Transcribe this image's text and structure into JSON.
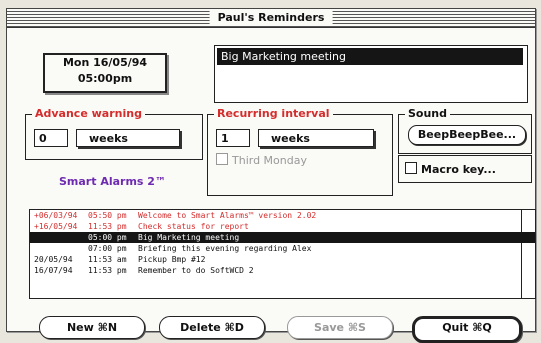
{
  "window": {
    "title": "Paul's Reminders"
  },
  "date_display": {
    "line1": "Mon 16/05/94",
    "line2": "05:00pm"
  },
  "message": {
    "text": "Big Marketing meeting"
  },
  "advance_warning": {
    "label": "Advance warning",
    "value": "0",
    "unit": "weeks"
  },
  "recurring_interval": {
    "label": "Recurring interval",
    "value": "1",
    "unit": "weeks",
    "third_monday": "Third Monday"
  },
  "sound": {
    "label": "Sound",
    "button": "BeepBeepBee..."
  },
  "macro_key": {
    "label": "Macro key..."
  },
  "smart_alarms": {
    "text": "Smart Alarms 2™"
  },
  "reminders": [
    {
      "date": "+06/03/94",
      "time": "05:50 pm",
      "text": "Welcome to Smart Alarms™ version 2.02",
      "style": "red"
    },
    {
      "date": "+16/05/94",
      "time": "11:53 pm",
      "text": "Check status for report",
      "style": "red"
    },
    {
      "date": "",
      "time": "05:00 pm",
      "text": "Big Marketing meeting",
      "style": "selected"
    },
    {
      "date": "",
      "time": "07:00 pm",
      "text": "Briefing this evening regarding Alex",
      "style": "normal"
    },
    {
      "date": "20/05/94",
      "time": "11:53 am",
      "text": "Pickup Bmp #12",
      "style": "normal"
    },
    {
      "date": "16/07/94",
      "time": "11:53 pm",
      "text": "Remember to do SoftWCD 2",
      "style": "normal"
    }
  ],
  "buttons": {
    "new": "New ⌘N",
    "delete": "Delete ⌘D",
    "save": "Save ⌘S",
    "quit": "Quit ⌘Q"
  },
  "colors": {
    "accent_red": "#d42d2d",
    "accent_purple": "#6e2bb0",
    "selection": "#151515"
  }
}
